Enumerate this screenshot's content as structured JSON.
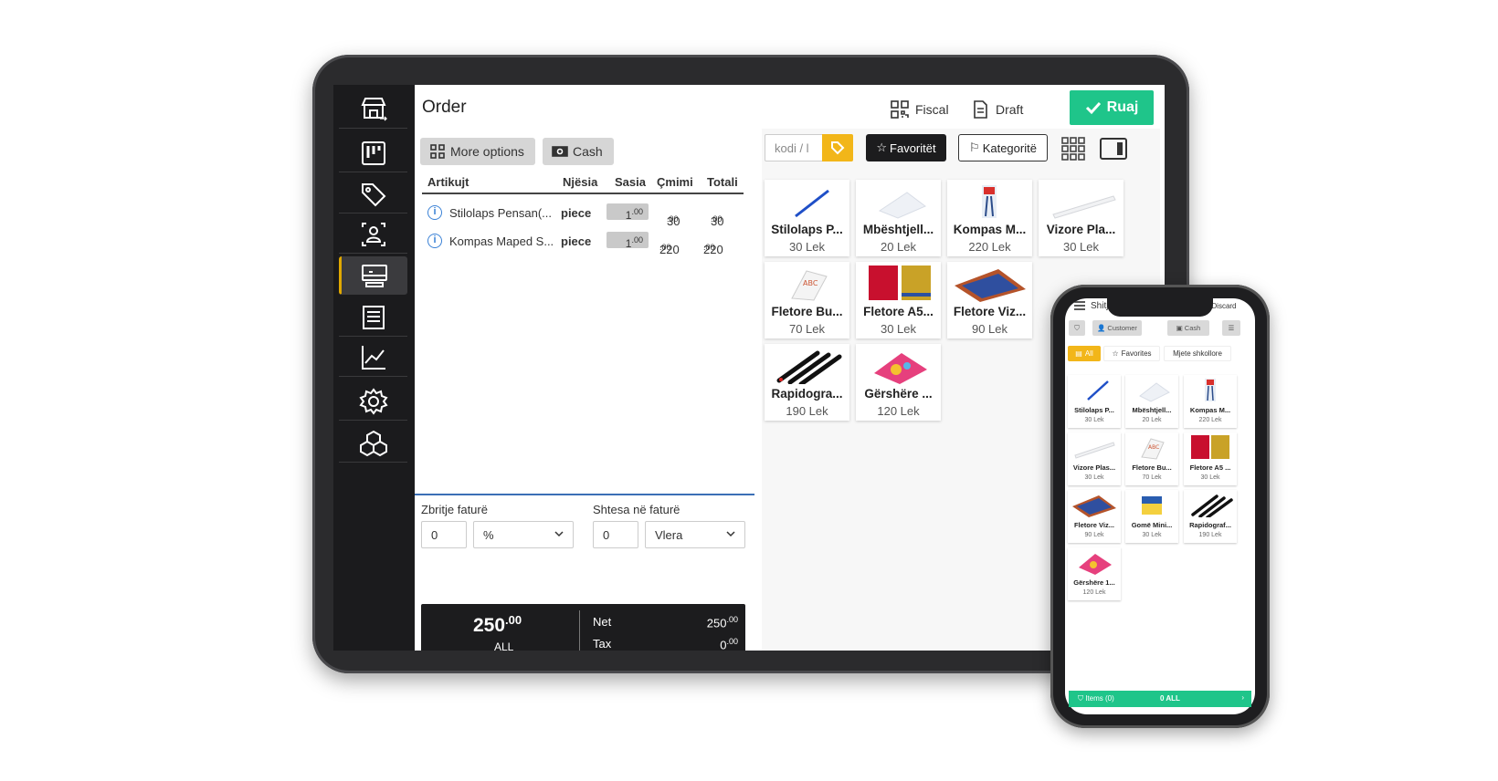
{
  "tablet": {
    "title": "Order",
    "top_buttons": {
      "fiscal": "Fiscal",
      "draft": "Draft",
      "save": "Ruaj"
    },
    "sidebar": [
      "store-switch-icon",
      "kanban-icon",
      "tags-icon",
      "contacts-icon",
      "pos-icon",
      "invoice-icon",
      "chart-icon",
      "settings-icon",
      "cubes-icon"
    ],
    "order": {
      "more_options": "More options",
      "cash": "Cash",
      "columns": {
        "item": "Artikujt",
        "unit": "Njësia",
        "qty": "Sasia",
        "price": "Çmimi",
        "total": "Totali"
      },
      "rows": [
        {
          "name": "Stilolaps Pensan(...",
          "unit": "piece",
          "qty": "1",
          "qty_dec": ".00",
          "price": "30",
          "price_dec": ".00",
          "total": "30",
          "total_dec": ".00"
        },
        {
          "name": "Kompas Maped S...",
          "unit": "piece",
          "qty": "1",
          "qty_dec": ".00",
          "price": "220",
          "price_dec": ".00",
          "total": "220",
          "total_dec": ".00"
        }
      ],
      "discount_label": "Zbritje faturë",
      "discount_value": "0",
      "discount_type": "%",
      "surcharge_label": "Shtesa në faturë",
      "surcharge_value": "0",
      "surcharge_type": "Vlera",
      "total": "250",
      "total_dec": ".00",
      "currency": "ALL",
      "net_label": "Net",
      "net_value": "250",
      "net_dec": ".00",
      "tax_label": "Tax",
      "tax_value": "0",
      "tax_dec": ".00"
    },
    "products_bar": {
      "search_placeholder": "kodi / l",
      "favorites": "Favoritët",
      "categories": "Kategoritë"
    },
    "products": [
      {
        "name": "Stilolaps P...",
        "price": "30 Lek"
      },
      {
        "name": "Mbështjell...",
        "price": "20 Lek"
      },
      {
        "name": "Kompas M...",
        "price": "220 Lek"
      },
      {
        "name": "Vizore Pla...",
        "price": "30 Lek"
      },
      {
        "name": "Fletore Bu...",
        "price": "70 Lek"
      },
      {
        "name": "Fletore A5...",
        "price": "30 Lek"
      },
      {
        "name": "Fletore Viz...",
        "price": "90 Lek"
      },
      {
        "name": "Rapidogra...",
        "price": "190 Lek"
      },
      {
        "name": "Gërshëre ...",
        "price": "120 Lek"
      }
    ]
  },
  "phone": {
    "title": "Shitje",
    "discard": "Discard",
    "customer": "Customer",
    "cash": "Cash",
    "tabs": {
      "all": "All",
      "favorites": "Favorites",
      "category": "Mjete shkollore"
    },
    "products": [
      {
        "name": "Stilolaps P...",
        "price": "30 Lek"
      },
      {
        "name": "Mbështjell...",
        "price": "20 Lek"
      },
      {
        "name": "Kompas M...",
        "price": "220 Lek"
      },
      {
        "name": "Vizore Plas...",
        "price": "30 Lek"
      },
      {
        "name": "Fletore Bu...",
        "price": "70 Lek"
      },
      {
        "name": "Fletore A5 ...",
        "price": "30 Lek"
      },
      {
        "name": "Fletore Viz...",
        "price": "90 Lek"
      },
      {
        "name": "Gomë Mini...",
        "price": "30 Lek"
      },
      {
        "name": "Rapidograf...",
        "price": "190 Lek"
      },
      {
        "name": "Gërshëre 1...",
        "price": "120 Lek"
      }
    ],
    "bottom": {
      "items": "Items (0)",
      "amount": "0 ALL"
    }
  },
  "colors": {
    "accent_green": "#1fc58a",
    "accent_yellow": "#f2b619",
    "dark": "#1c1c1e"
  }
}
